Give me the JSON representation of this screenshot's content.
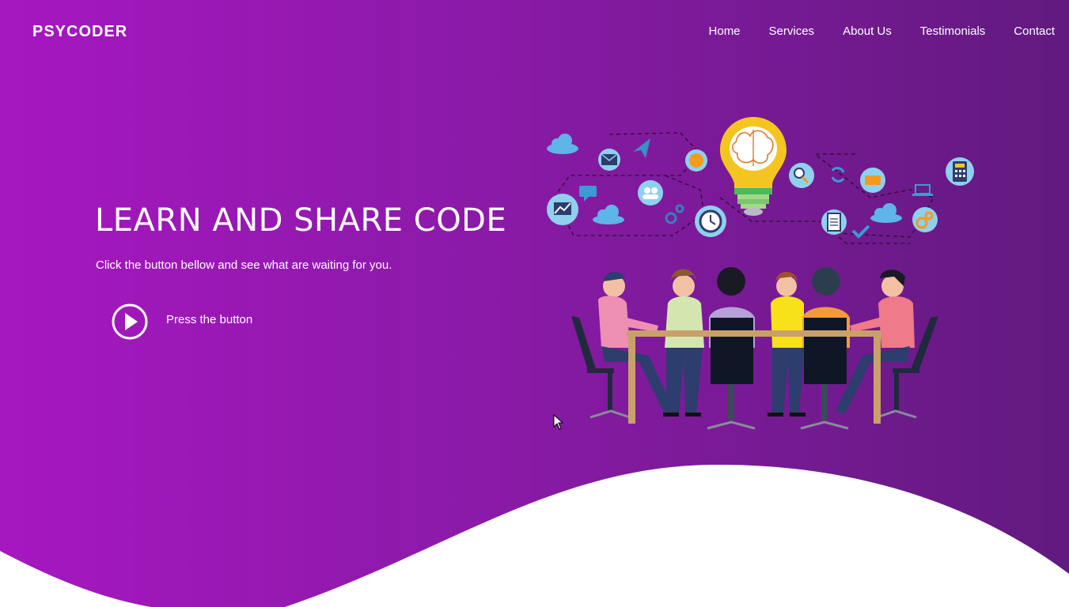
{
  "brand": {
    "name": "PSYCODER"
  },
  "nav": {
    "items": [
      {
        "label": "Home"
      },
      {
        "label": "Services"
      },
      {
        "label": "About Us"
      },
      {
        "label": "Testimonials"
      },
      {
        "label": "Contact"
      }
    ]
  },
  "hero": {
    "title": "LEARN AND SHARE CODE",
    "subtitle": "Click the button bellow and see what are waiting for you.",
    "button_label": "Press the button"
  },
  "colors": {
    "gradient_start": "#a617c0",
    "gradient_end": "#611a7f",
    "wave": "#ffffff",
    "bulb": "#f4c520"
  },
  "icons": {
    "play": "play-circle-icon",
    "illustration": "team-meeting-illustration"
  }
}
